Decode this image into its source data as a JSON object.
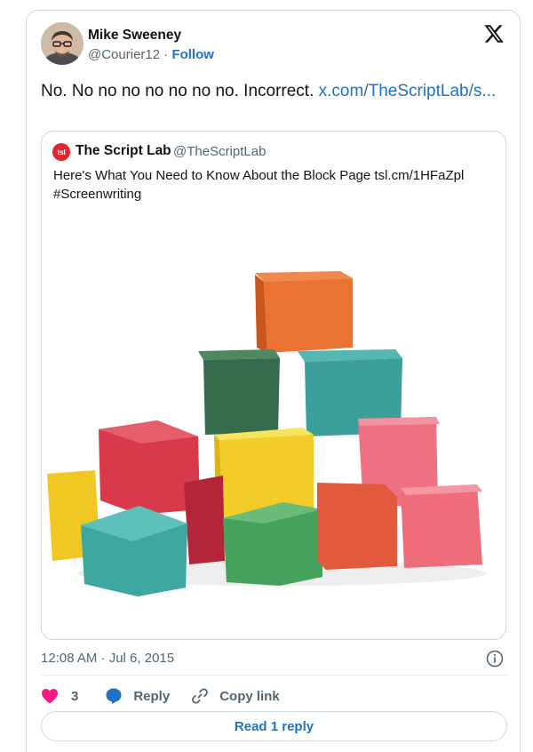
{
  "author": {
    "name": "Mike Sweeney",
    "handle": "@Courier12",
    "separator": "·",
    "follow_label": "Follow"
  },
  "tweet": {
    "text": "No. No no no no no no no. Incorrect. ",
    "link_text": "x.com/TheScriptLab/s..."
  },
  "quote": {
    "logo_text": "tsl",
    "name": "The Script Lab",
    "handle": "@TheScriptLab",
    "text": "Here's What You Need to Know About the Block Page tsl.cm/1HFaZpl #Screenwriting",
    "image_alt": "Stacked colorful wooden toy blocks"
  },
  "meta": {
    "timestamp": "12:08 AM · Jul 6, 2015"
  },
  "actions": {
    "like_count": "3",
    "reply_label": "Reply",
    "copy_link_label": "Copy link"
  },
  "read_replies_label": "Read 1 reply",
  "colors": {
    "link": "#1d72c4",
    "like": "#f91880",
    "reply": "#1d72c4",
    "text_secondary": "#536471",
    "border": "#cfd9de"
  },
  "icons": {
    "brand": "x-logo-icon",
    "info": "info-icon",
    "like": "heart-icon",
    "reply": "speech-bubble-icon",
    "copy": "link-icon"
  }
}
